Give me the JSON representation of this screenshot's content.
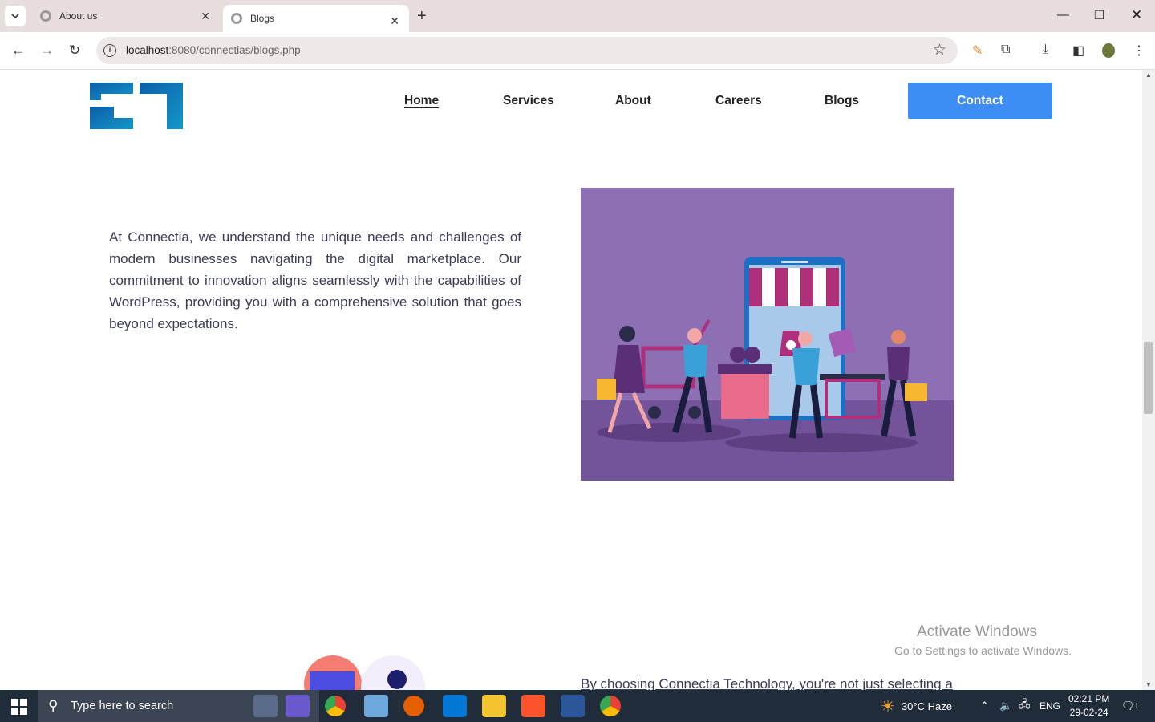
{
  "browser": {
    "tabs": [
      {
        "title": "About us",
        "active": false
      },
      {
        "title": "Blogs",
        "active": true
      }
    ],
    "url_host": "localhost",
    "url_rest": ":8080/connectias/blogs.php"
  },
  "nav": {
    "links": [
      "Home",
      "Services",
      "About",
      "Careers",
      "Blogs"
    ],
    "active": "Home",
    "contact_label": "Contact"
  },
  "content": {
    "intro": "At Connectia, we understand the unique needs and challenges of modern businesses navigating the digital marketplace. Our commitment to innovation aligns seamlessly with the capabilities of WordPress, providing you with a comprehensive solution that goes beyond expectations.",
    "para2_start": "By choosing Connectia Technology, you're not just selecting a"
  },
  "watermark": {
    "title": "Activate Windows",
    "subtitle": "Go to Settings to activate Windows."
  },
  "taskbar": {
    "search_placeholder": "Type here to search",
    "weather": "30°C  Haze",
    "lang": "ENG",
    "time": "02:21 PM",
    "date": "29-02-24",
    "notification_count": "1"
  },
  "colors": {
    "accent": "#3d8ef4",
    "hero_bg": "#8c70b3",
    "logo": "#0b6fb0"
  }
}
